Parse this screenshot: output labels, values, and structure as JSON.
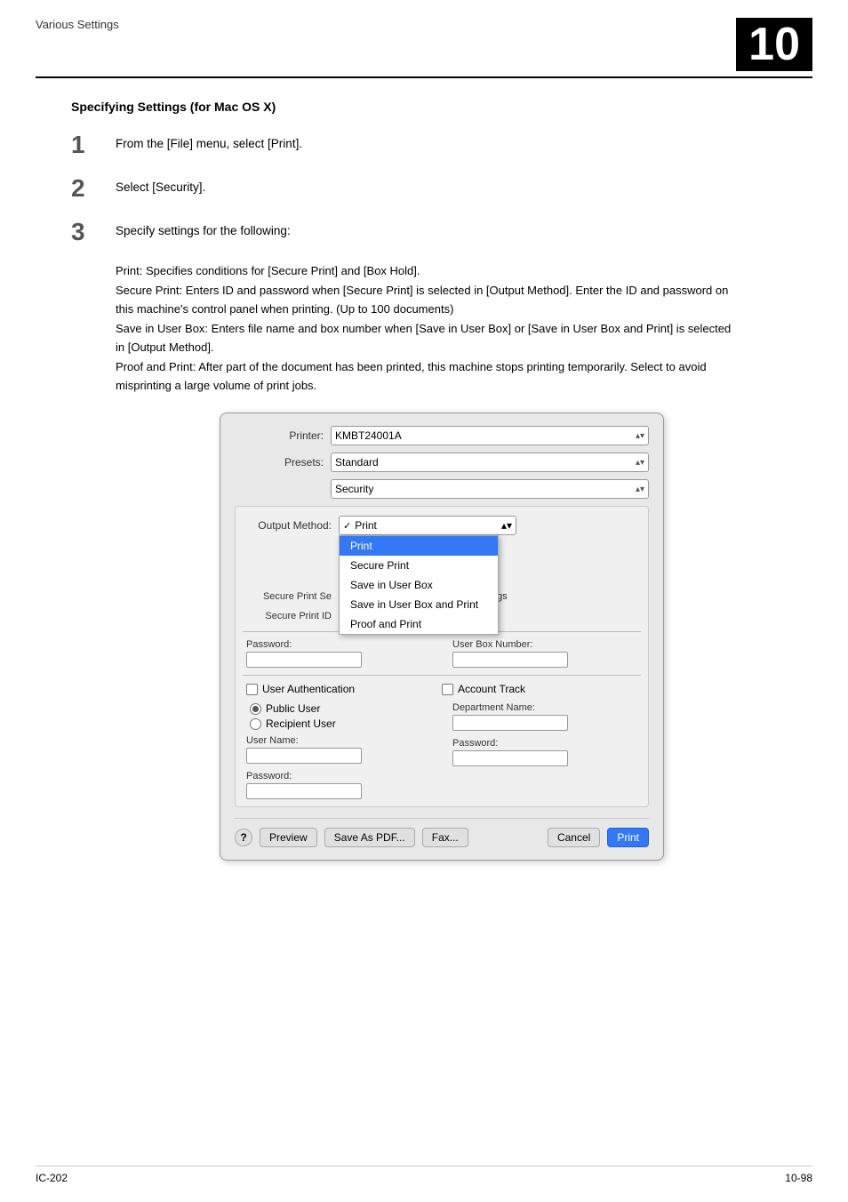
{
  "header": {
    "title": "Various Settings",
    "chapter": "10"
  },
  "section": {
    "title": "Specifying Settings (for Mac OS X)"
  },
  "steps": [
    {
      "number": "1",
      "text": "From the [File] menu, select [Print]."
    },
    {
      "number": "2",
      "text": "Select [Security]."
    },
    {
      "number": "3",
      "text": "Specify settings for the following:",
      "description": "Print: Specifies conditions for [Secure Print] and [Box Hold].\nSecure Print: Enters ID and password when [Secure Print] is selected in [Output Method]. Enter the ID and password on this machine's control panel when printing. (Up to 100 documents)\nSave in User Box: Enters file name and box number when [Save in User Box] or [Save in User Box and Print] is selected in [Output Method].\nProof and Print: After part of the document has been printed, this machine stops printing temporarily. Select to avoid misprinting a large volume of print jobs."
    }
  ],
  "dialog": {
    "printer_label": "Printer:",
    "printer_value": "KMBT24001A",
    "presets_label": "Presets:",
    "presets_value": "Standard",
    "panel_label": "Security",
    "output_method_label": "Output Method:",
    "output_method_value": "Print",
    "dropdown_items": [
      {
        "label": "Print",
        "active": true
      },
      {
        "label": "Secure Print"
      },
      {
        "label": "Save in User Box"
      },
      {
        "label": "Save in User Box and Print"
      },
      {
        "label": "Proof and Print"
      }
    ],
    "secure_print_id_label": "Secure Print Se",
    "secure_print_id_placeholder": "",
    "box_settings_label": "Box Settings",
    "secure_print_id_label2": "Secure Print ID",
    "password_label": "Password:",
    "user_box_number_label": "User Box Number:",
    "user_auth_label": "User Authentication",
    "account_track_label": "Account Track",
    "public_user_label": "Public User",
    "recipient_user_label": "Recipient User",
    "user_name_label": "User Name:",
    "department_name_label": "Department Name:",
    "password_label2": "Password:",
    "password_label3": "Password:",
    "buttons": {
      "help": "?",
      "preview": "Preview",
      "save_as_pdf": "Save As PDF...",
      "fax": "Fax...",
      "cancel": "Cancel",
      "print": "Print"
    }
  },
  "footer": {
    "left": "IC-202",
    "right": "10-98"
  }
}
